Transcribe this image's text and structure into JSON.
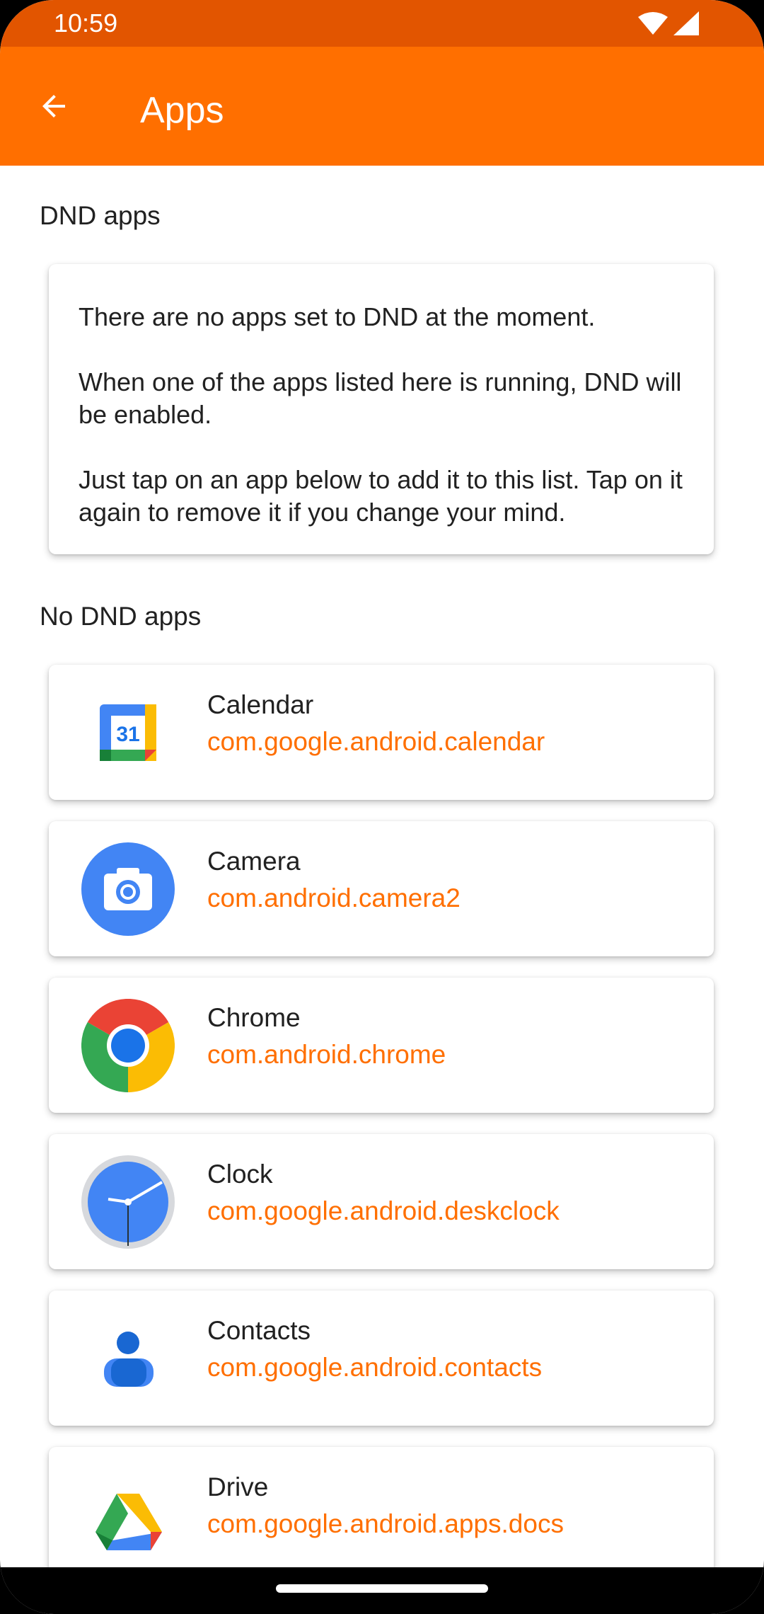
{
  "status": {
    "time": "10:59"
  },
  "appbar": {
    "title": "Apps"
  },
  "sections": {
    "dnd": "DND apps",
    "no_dnd": "No DND apps"
  },
  "info": {
    "lines": [
      "There are no apps set to DND at the moment.",
      "When one of the apps listed here is running, DND will be enabled.",
      "Just tap on an app below to add it to this list. Tap on it again to remove it if you change your mind."
    ]
  },
  "apps": [
    {
      "name": "Calendar",
      "package": "com.google.android.calendar",
      "icon": "calendar-icon",
      "icon_text": "31"
    },
    {
      "name": "Camera",
      "package": "com.android.camera2",
      "icon": "camera-icon"
    },
    {
      "name": "Chrome",
      "package": "com.android.chrome",
      "icon": "chrome-icon"
    },
    {
      "name": "Clock",
      "package": "com.google.android.deskclock",
      "icon": "clock-icon"
    },
    {
      "name": "Contacts",
      "package": "com.google.android.contacts",
      "icon": "contacts-icon"
    },
    {
      "name": "Drive",
      "package": "com.google.android.apps.docs",
      "icon": "drive-icon"
    }
  ],
  "colors": {
    "accent": "#FF6F00",
    "status_bar": "#E25500",
    "text": "#212121"
  }
}
